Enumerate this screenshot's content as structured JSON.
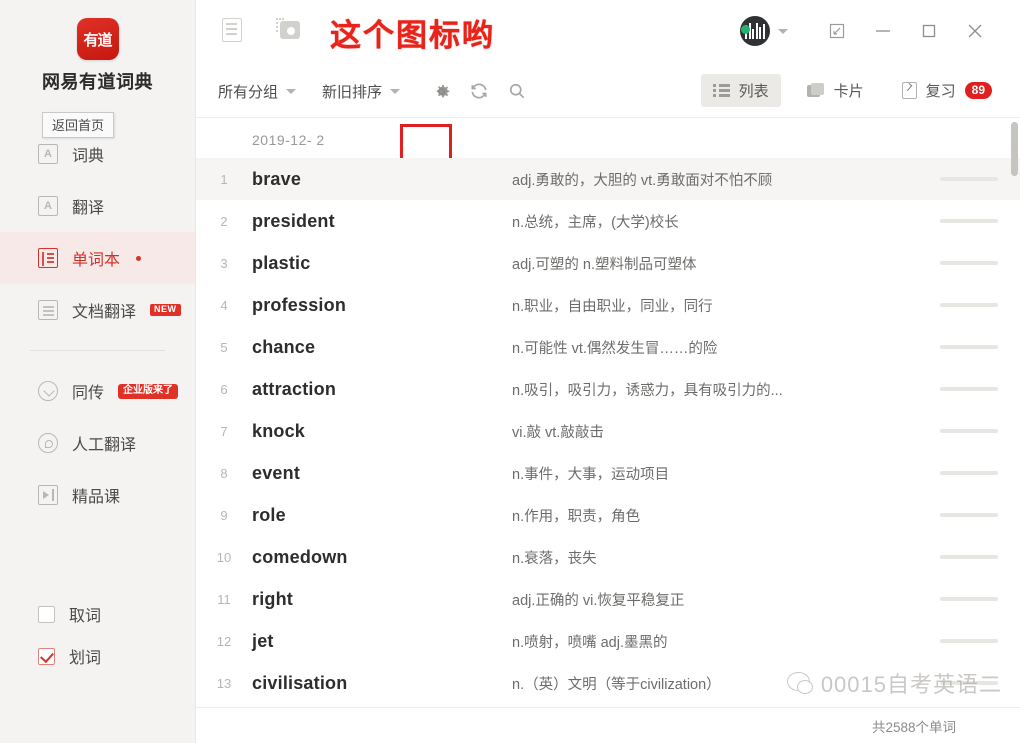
{
  "sidebar": {
    "logo_text": "有道",
    "app_title": "网易有道词典",
    "home_tooltip": "返回首页",
    "items": [
      {
        "label": "词典",
        "icon": "dictionary-icon",
        "active": false,
        "badge": ""
      },
      {
        "label": "翻译",
        "icon": "translate-icon",
        "active": false,
        "badge": ""
      },
      {
        "label": "单词本",
        "icon": "wordbook-icon",
        "active": true,
        "badge": "dot"
      },
      {
        "label": "文档翻译",
        "icon": "document-translate-icon",
        "active": false,
        "badge": "NEW"
      }
    ],
    "items2": [
      {
        "label": "同传",
        "icon": "simultaneous-interpretation-icon",
        "badge": "企业版来了"
      },
      {
        "label": "人工翻译",
        "icon": "human-translation-icon",
        "badge": ""
      },
      {
        "label": "精品课",
        "icon": "course-icon",
        "badge": ""
      }
    ],
    "checkboxes": [
      {
        "label": "取词",
        "checked": false
      },
      {
        "label": "划词",
        "checked": true
      }
    ]
  },
  "titlebar": {
    "doc_icon": "document-icon",
    "camera_icon": "screenshot-camera-icon",
    "avatar": "user-avatar",
    "controls": [
      "expand",
      "minimize",
      "maximize",
      "close"
    ]
  },
  "annotation": {
    "text": "这个图标哟",
    "color": "#e8241a",
    "target": "settings-gear-icon"
  },
  "toolbar": {
    "group_filter": "所有分组",
    "sort_filter": "新旧排序",
    "gear_icon": "settings-gear-icon",
    "refresh_icon": "refresh-icon",
    "search_icon": "search-icon",
    "views": [
      {
        "label": "列表",
        "icon": "list-view-icon",
        "active": true
      },
      {
        "label": "卡片",
        "icon": "card-view-icon",
        "active": false
      }
    ],
    "review": {
      "label": "复习",
      "icon": "review-clipboard-icon",
      "badge": "89",
      "badge_color": "#e02020"
    }
  },
  "list": {
    "date_header": "2019-12- 2",
    "rows": [
      {
        "num": "1",
        "word": "brave",
        "def": "adj.勇敢的，大胆的 vt.勇敢面对不怕不顾",
        "highlight": true
      },
      {
        "num": "2",
        "word": "president",
        "def": "n.总统，主席，(大学)校长",
        "highlight": false
      },
      {
        "num": "3",
        "word": "plastic",
        "def": "adj.可塑的 n.塑料制品可塑体",
        "highlight": false
      },
      {
        "num": "4",
        "word": "profession",
        "def": "n.职业，自由职业，同业，同行",
        "highlight": false
      },
      {
        "num": "5",
        "word": "chance",
        "def": "n.可能性 vt.偶然发生冒……的险",
        "highlight": false
      },
      {
        "num": "6",
        "word": "attraction",
        "def": "n.吸引，吸引力，诱惑力，具有吸引力的...",
        "highlight": false
      },
      {
        "num": "7",
        "word": "knock",
        "def": "vi.敲 vt.敲敲击",
        "highlight": false
      },
      {
        "num": "8",
        "word": "event",
        "def": "n.事件，大事，运动项目",
        "highlight": false
      },
      {
        "num": "9",
        "word": "role",
        "def": "n.作用，职责，角色",
        "highlight": false
      },
      {
        "num": "10",
        "word": "comedown",
        "def": "n.衰落，丧失",
        "highlight": false
      },
      {
        "num": "11",
        "word": "right",
        "def": "adj.正确的 vi.恢复平稳复正",
        "highlight": false
      },
      {
        "num": "12",
        "word": "jet",
        "def": "n.喷射，喷嘴 adj.墨黑的",
        "highlight": false
      },
      {
        "num": "13",
        "word": "civilisation",
        "def": "n.（英）文明（等于civilization）",
        "highlight": false
      }
    ]
  },
  "footer": {
    "count_text": "共2588个单词"
  },
  "watermark": {
    "text": "00015自考英语二",
    "icon": "wechat-icon"
  }
}
